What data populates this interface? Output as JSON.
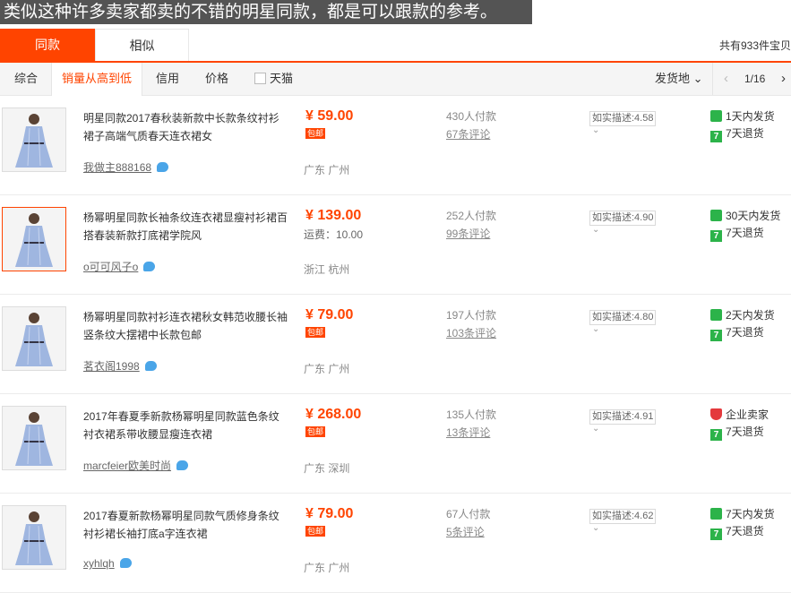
{
  "banner": "类似这种许多卖家都卖的不错的明星同款，都是可以跟款的参考。",
  "tabs": [
    {
      "label": "同款"
    },
    {
      "label": "相似"
    }
  ],
  "total_text": "共有933件宝贝",
  "sort": {
    "items": [
      "综合",
      "销量从高到低",
      "信用",
      "价格"
    ],
    "tmall_label": "天猫",
    "origin_label": "发货地 ⌄",
    "pager": {
      "prev": "‹",
      "page": "1/16",
      "next": "›"
    }
  },
  "products": [
    {
      "title": "明星同款2017春秋装新款中长款条纹衬衫裙子高端气质春天连衣裙女",
      "seller": "我做主888168",
      "price": "¥ 59.00",
      "shipping_badge": "包邮",
      "shipping_text": "",
      "location": "广东 广州",
      "paid": "430人付款",
      "reviews": "67条评论",
      "desc": "如实描述:4.58",
      "chev": "⌄",
      "svc1": "1天内发货",
      "svc2": "7天退货",
      "svc1_icon": "clock-icon",
      "selected": false
    },
    {
      "title": "杨幂明星同款长袖条纹连衣裙显瘦衬衫裙百搭春装新款打底裙学院风",
      "seller": "o可可风子o",
      "price": "¥ 139.00",
      "shipping_badge": "",
      "shipping_text": "运费：10.00",
      "location": "浙江 杭州",
      "paid": "252人付款",
      "reviews": "99条评论",
      "desc": "如实描述:4.90",
      "chev": "⌄",
      "svc1": "30天内发货",
      "svc2": "7天退货",
      "svc1_icon": "clock-icon",
      "selected": true
    },
    {
      "title": "杨幂明星同款衬衫连衣裙秋女韩范收腰长袖竖条纹大摆裙中长款包邮",
      "seller": "茗衣阁1998",
      "price": "¥ 79.00",
      "shipping_badge": "包邮",
      "shipping_text": "",
      "location": "广东 广州",
      "paid": "197人付款",
      "reviews": "103条评论",
      "desc": "如实描述:4.80",
      "chev": "⌄",
      "svc1": "2天内发货",
      "svc2": "7天退货",
      "svc1_icon": "clock-icon",
      "selected": false
    },
    {
      "title": "2017年春夏季新款杨幂明星同款蓝色条纹衬衣裙系带收腰显瘦连衣裙",
      "seller": "marcfeier欧美时尚",
      "price": "¥ 268.00",
      "shipping_badge": "包邮",
      "shipping_text": "",
      "location": "广东 深圳",
      "paid": "135人付款",
      "reviews": "13条评论",
      "desc": "如实描述:4.91",
      "chev": "⌄",
      "svc1": "企业卖家",
      "svc2": "7天退货",
      "svc1_icon": "shield-icon",
      "selected": false
    },
    {
      "title": "2017春夏新款杨幂明星同款气质修身条纹衬衫裙长袖打底a字连衣裙",
      "seller": "xyhlqh",
      "price": "¥ 79.00",
      "shipping_badge": "包邮",
      "shipping_text": "",
      "location": "广东 广州",
      "paid": "67人付款",
      "reviews": "5条评论",
      "desc": "如实描述:4.62",
      "chev": "⌄",
      "svc1": "7天内发货",
      "svc2": "7天退货",
      "svc1_icon": "clock-icon",
      "selected": false
    }
  ],
  "colors": {
    "accent": "#ff4400",
    "service_green": "#2cb34a",
    "enterprise_red": "#e4393c",
    "dress_blue": "#9fb6e0"
  }
}
